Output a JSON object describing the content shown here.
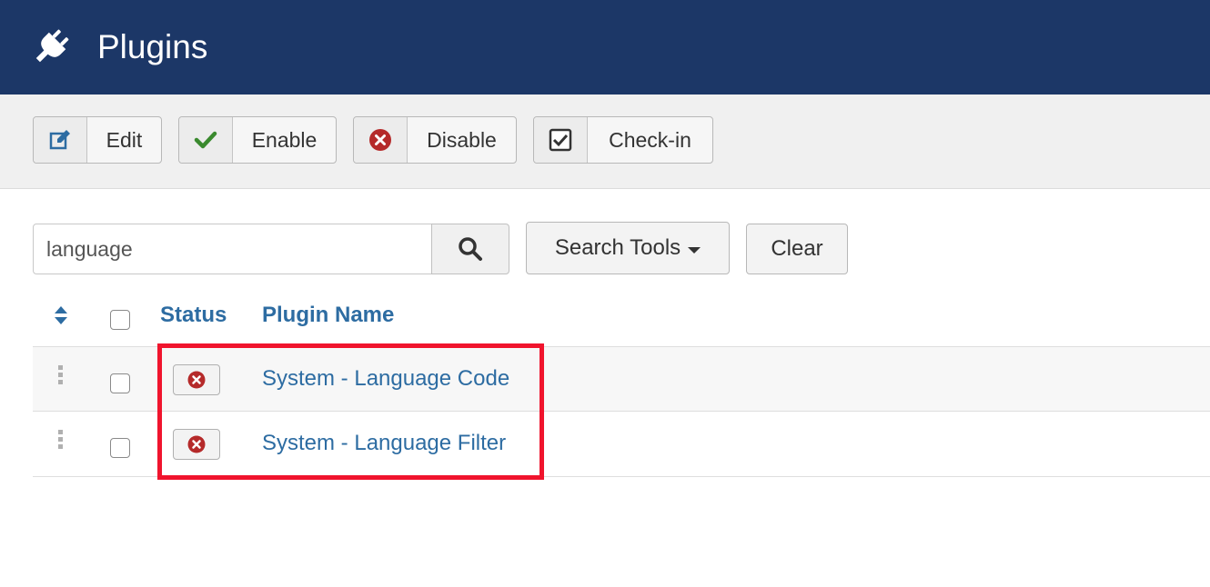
{
  "header": {
    "title": "Plugins",
    "icon": "plug-icon"
  },
  "toolbar": {
    "edit_label": "Edit",
    "enable_label": "Enable",
    "disable_label": "Disable",
    "checkin_label": "Check-in"
  },
  "filter": {
    "search_value": "language",
    "search_tools_label": "Search Tools",
    "clear_label": "Clear"
  },
  "table": {
    "columns": {
      "status": "Status",
      "plugin_name": "Plugin Name"
    },
    "rows": [
      {
        "name": "System - Language Code",
        "status": "disabled"
      },
      {
        "name": "System - Language Filter",
        "status": "disabled"
      }
    ]
  },
  "colors": {
    "header_bg": "#1c3767",
    "link": "#2d6ca2",
    "disabled_icon": "#b52a2a",
    "enable_check": "#3a8a2e",
    "highlight_border": "#f0142d"
  }
}
